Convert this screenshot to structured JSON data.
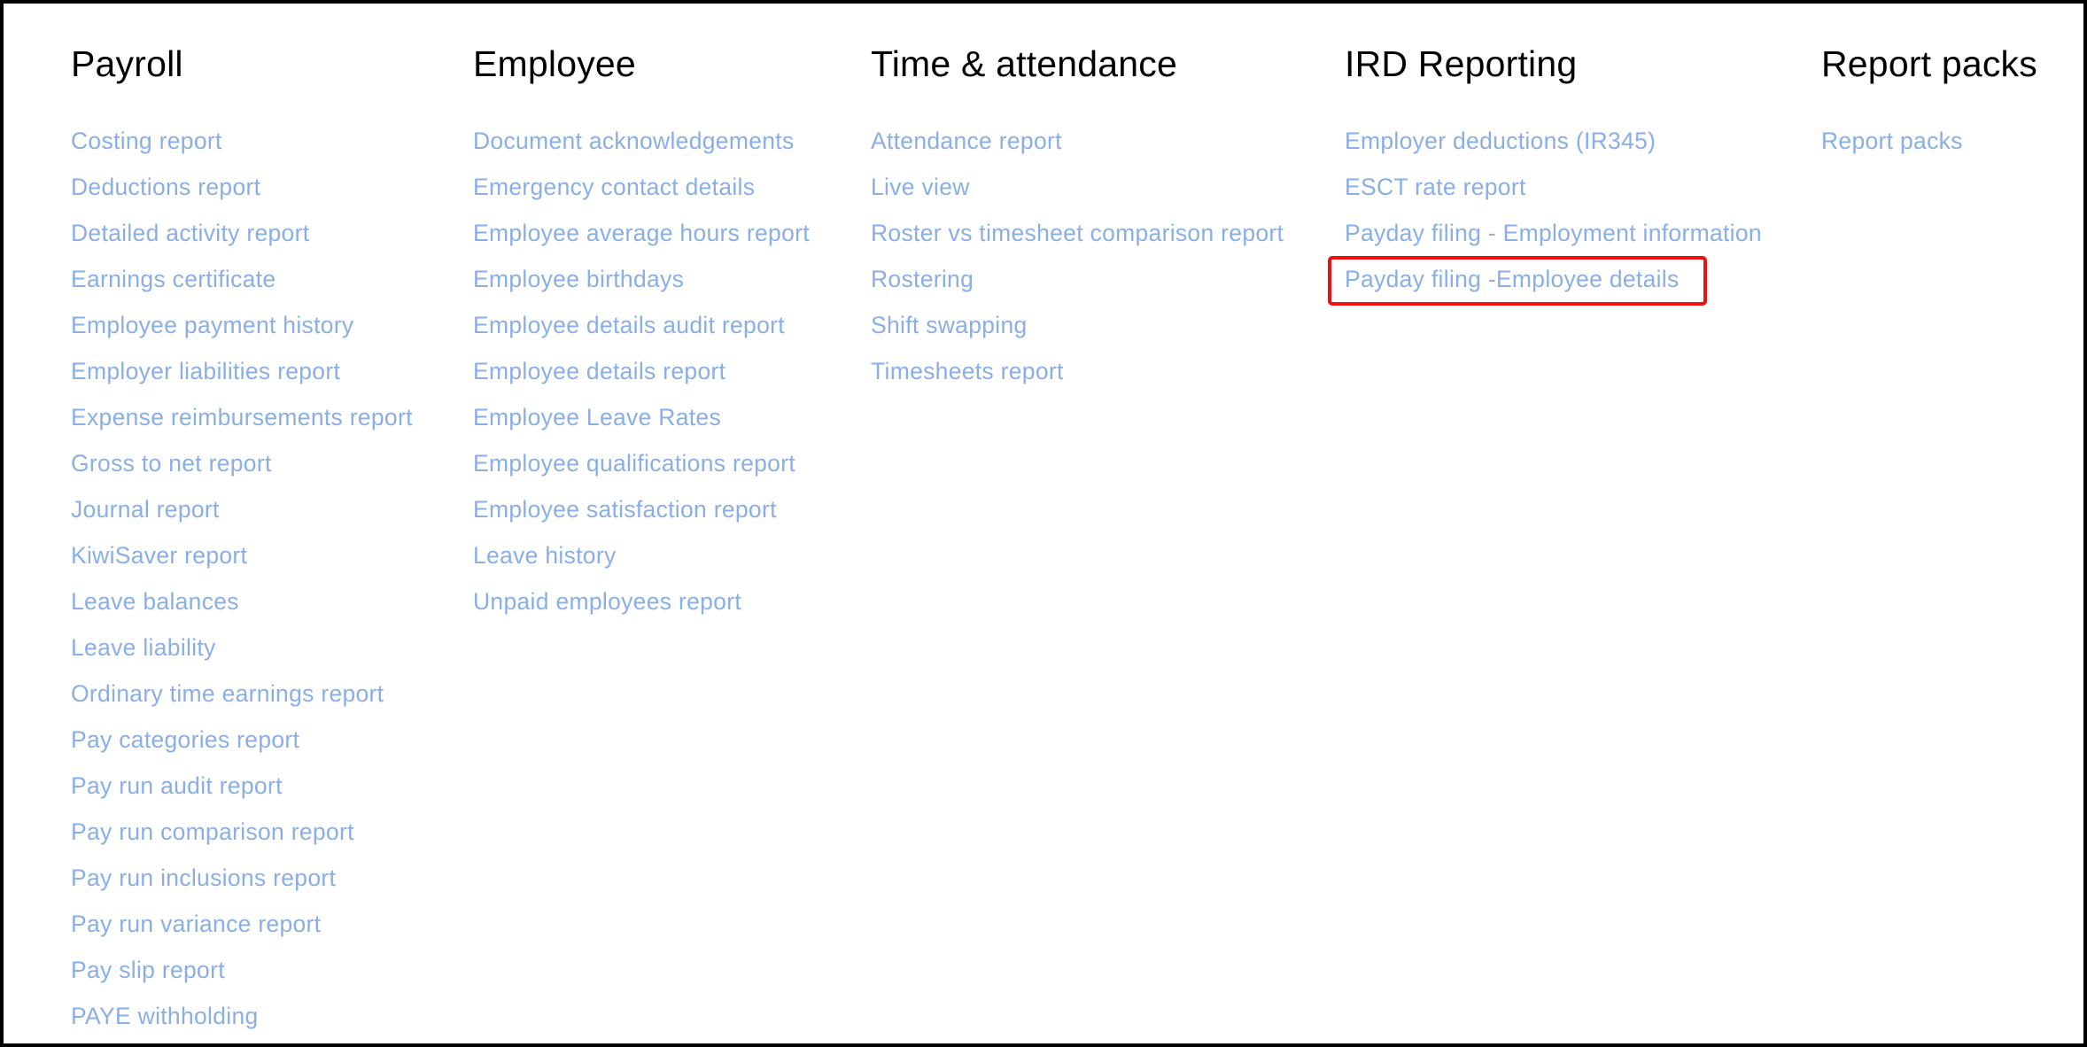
{
  "columns": [
    {
      "id": "payroll",
      "heading": "Payroll",
      "items": [
        "Costing report",
        "Deductions report",
        "Detailed activity report",
        "Earnings certificate",
        "Employee payment history",
        "Employer liabilities report",
        "Expense reimbursements report",
        "Gross to net report",
        "Journal report",
        "KiwiSaver report",
        "Leave balances",
        "Leave liability",
        "Ordinary time earnings report",
        "Pay categories report",
        "Pay run audit report",
        "Pay run comparison report",
        "Pay run inclusions report",
        "Pay run variance report",
        "Pay slip report",
        "PAYE withholding"
      ]
    },
    {
      "id": "employee",
      "heading": "Employee",
      "items": [
        "Document acknowledgements",
        "Emergency contact details",
        "Employee average hours report",
        "Employee birthdays",
        "Employee details audit report",
        "Employee details report",
        "Employee Leave Rates",
        "Employee qualifications report",
        "Employee satisfaction report",
        "Leave history",
        "Unpaid employees report"
      ]
    },
    {
      "id": "time-attendance",
      "heading": "Time & attendance",
      "items": [
        "Attendance report",
        "Live view",
        "Roster vs timesheet comparison report",
        "Rostering",
        "Shift swapping",
        "Timesheets report"
      ]
    },
    {
      "id": "ird-reporting",
      "heading": "IRD Reporting",
      "items": [
        "Employer deductions (IR345)",
        "ESCT rate report",
        "Payday filing - Employment information",
        "Payday filing -Employee details"
      ]
    },
    {
      "id": "report-packs",
      "heading": "Report packs",
      "items": [
        "Report packs"
      ]
    }
  ],
  "colors": {
    "heading": "#000000",
    "link": "#8aaee6",
    "highlight": "#ee1111",
    "border": "#000000"
  }
}
